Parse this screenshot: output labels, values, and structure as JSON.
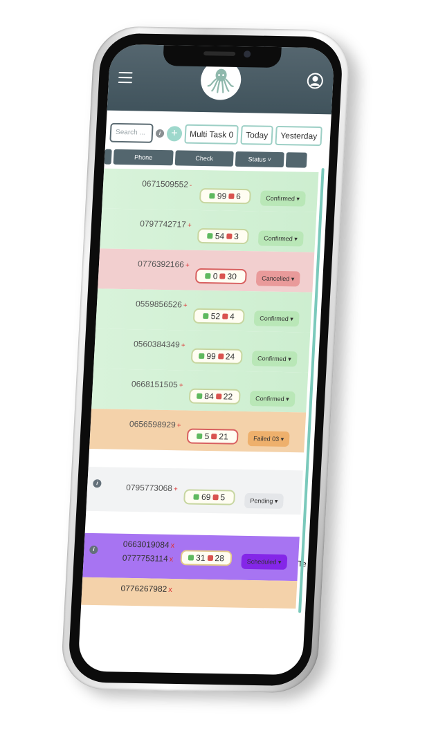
{
  "header": {
    "menu_icon": "hamburger-icon",
    "logo_icon": "octopus-logo",
    "profile_icon": "user-circle-icon"
  },
  "toolbar": {
    "search_placeholder": "Search ...",
    "info_label": "i",
    "add_label": "+",
    "multi_task_label": "Multi Task 0",
    "today_label": "Today",
    "yesterday_label": "Yesterday"
  },
  "columns": {
    "phone": "Phone",
    "check": "Check",
    "status": "Status ˅"
  },
  "rows": [
    {
      "phone": "0671509552",
      "sign": "-",
      "good": "99",
      "bad": "6",
      "status": "Confirmed ▾",
      "kind": "green"
    },
    {
      "phone": "0797742717",
      "sign": "+",
      "good": "54",
      "bad": "3",
      "status": "Confirmed ▾",
      "kind": "green"
    },
    {
      "phone": "0776392166",
      "sign": "+",
      "good": "0",
      "bad": "30",
      "status": "Cancelled ▾",
      "kind": "red"
    },
    {
      "phone": "0559856526",
      "sign": "+",
      "good": "52",
      "bad": "4",
      "status": "Confirmed ▾",
      "kind": "green"
    },
    {
      "phone": "0560384349",
      "sign": "+",
      "good": "99",
      "bad": "24",
      "status": "Confirmed ▾",
      "kind": "green"
    },
    {
      "phone": "0668151505",
      "sign": "+",
      "good": "84",
      "bad": "22",
      "status": "Confirmed ▾",
      "kind": "green"
    },
    {
      "phone": "0656598929",
      "sign": "+",
      "good": "5",
      "bad": "21",
      "status": "Failed 03 ▾",
      "kind": "orange"
    },
    {
      "phone": "0795773068",
      "sign": "+",
      "good": "69",
      "bad": "5",
      "status": "Pending ▾",
      "kind": "gray"
    },
    {
      "phone": "0663019084",
      "phone2": "0777753114",
      "sign": "x",
      "good": "31",
      "bad": "28",
      "status": "Scheduled ▾",
      "kind": "purple",
      "trailing": "Te"
    },
    {
      "phone": "0776267982",
      "sign": "x",
      "kind": "orange-partial"
    }
  ],
  "colors": {
    "header": "#40535c",
    "accent": "#9ccfc5",
    "confirmed": "#b9e7b7",
    "cancelled": "#e99a9a",
    "failed": "#eeb06c",
    "scheduled": "#8426e8"
  }
}
